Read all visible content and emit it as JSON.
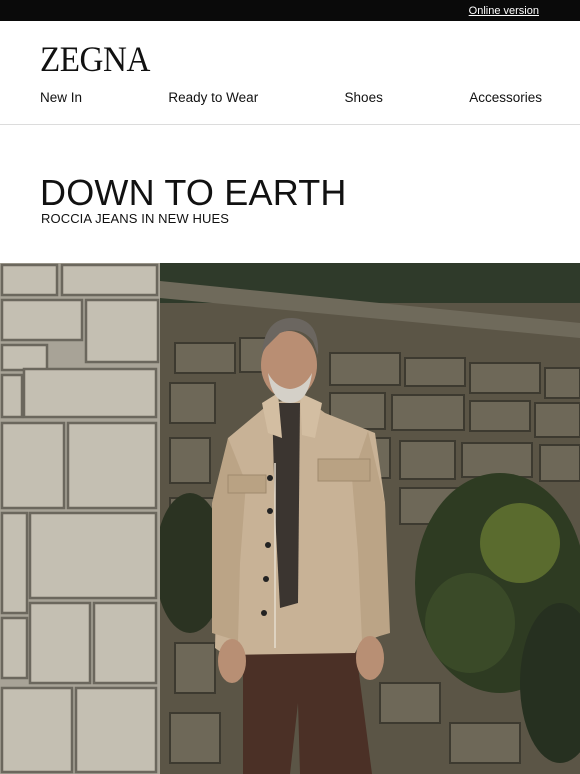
{
  "topbar": {
    "online_version": "Online version"
  },
  "brand": {
    "logo_text": "ZEGNA"
  },
  "nav": {
    "items": [
      {
        "label": "New In"
      },
      {
        "label": "Ready to Wear"
      },
      {
        "label": "Shoes"
      },
      {
        "label": "Accessories"
      }
    ]
  },
  "hero": {
    "title": "DOWN TO EARTH",
    "subtitle": "ROCCIA JEANS IN NEW HUES"
  },
  "colors": {
    "topbar_bg": "#0a0a0a",
    "stone": "#bdb8ac",
    "jacket": "#c8b296",
    "trousers": "#4b3026"
  }
}
